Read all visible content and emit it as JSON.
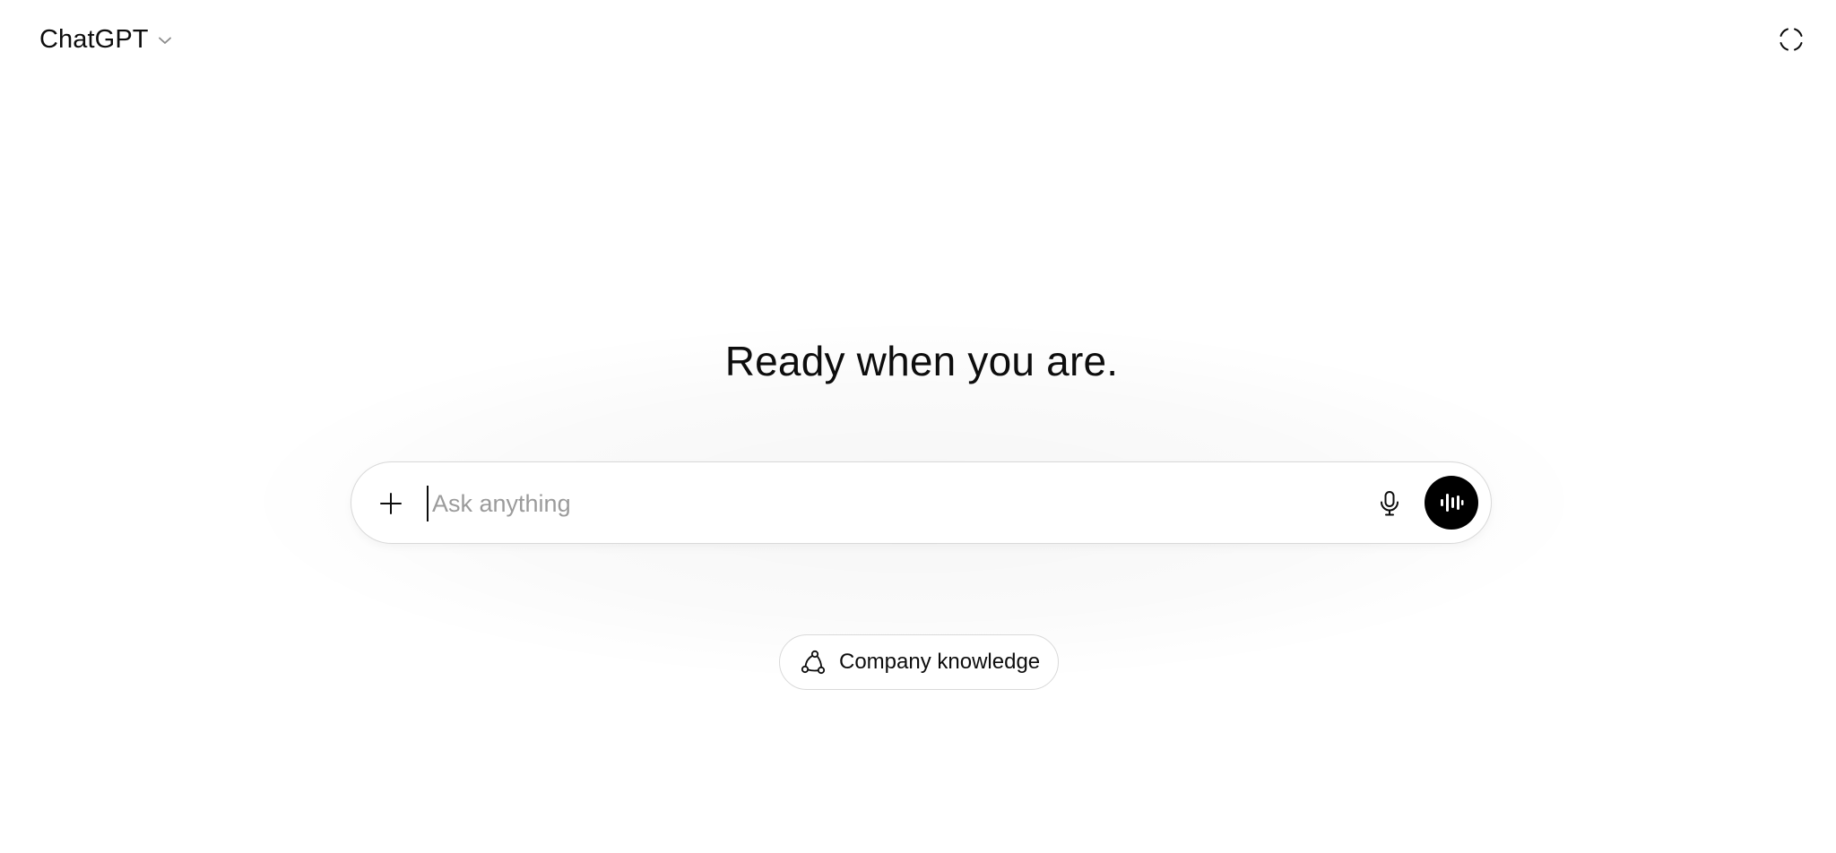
{
  "header": {
    "model_name": "ChatGPT",
    "model_chevron_icon": "chevron-down-icon",
    "temporary_chat_icon": "dashed-circle-icon"
  },
  "main": {
    "headline": "Ready when you are."
  },
  "composer": {
    "placeholder": "Ask anything",
    "value": "",
    "add_icon": "plus-icon",
    "dictate_icon": "microphone-icon",
    "voice_icon": "voice-waveform-icon"
  },
  "suggestions": [
    {
      "label": "Company knowledge",
      "icon": "connectors-icon"
    }
  ],
  "colors": {
    "background": "#ffffff",
    "text": "#0d0d0d",
    "placeholder": "#9b9b9b",
    "border": "#d9d9d9",
    "voice_button": "#000000"
  }
}
